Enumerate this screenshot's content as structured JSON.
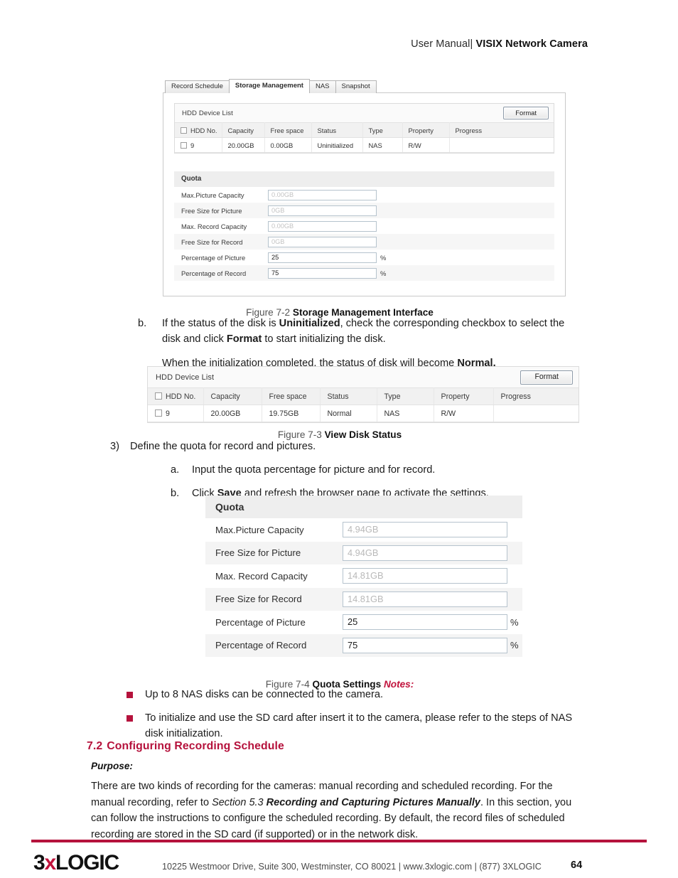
{
  "header": {
    "plain": "User Manual|",
    "bold": "VISIX Network Camera"
  },
  "figure_7_2": {
    "tabs": [
      {
        "label": "Record Schedule",
        "active": false
      },
      {
        "label": "Storage Management",
        "active": true
      },
      {
        "label": "NAS",
        "active": false
      },
      {
        "label": "Snapshot",
        "active": false
      }
    ],
    "hdd_list": {
      "title": "HDD Device List",
      "format_button": "Format",
      "columns": [
        "HDD No.",
        "Capacity",
        "Free space",
        "Status",
        "Type",
        "Property",
        "Progress"
      ],
      "rows": [
        {
          "no": "9",
          "capacity": "20.00GB",
          "free_space": "0.00GB",
          "status": "Uninitialized",
          "type": "NAS",
          "property": "R/W",
          "progress": ""
        }
      ]
    },
    "quota": {
      "title": "Quota",
      "fields": [
        {
          "label": "Max.Picture Capacity",
          "value": "0.00GB",
          "readonly": true,
          "suffix": ""
        },
        {
          "label": "Free Size for Picture",
          "value": "0GB",
          "readonly": true,
          "suffix": ""
        },
        {
          "label": "Max. Record Capacity",
          "value": "0.00GB",
          "readonly": true,
          "suffix": ""
        },
        {
          "label": "Free Size for Record",
          "value": "0GB",
          "readonly": true,
          "suffix": ""
        },
        {
          "label": "Percentage of Picture",
          "value": "25",
          "readonly": false,
          "suffix": "%"
        },
        {
          "label": "Percentage of Record",
          "value": "75",
          "readonly": false,
          "suffix": "%"
        }
      ]
    },
    "caption_num": "Figure 7-2",
    "caption_title": "Storage Management Interface"
  },
  "step_b": {
    "marker": "b.",
    "line1_pre": "If the status of the disk is ",
    "line1_bold1": "Uninitialized",
    "line1_mid": ", check the corresponding checkbox to select the disk and click ",
    "line1_bold2": "Format",
    "line1_post": " to start initializing the disk.",
    "line2_pre": "When the initialization completed, the status of disk will become ",
    "line2_bold": "Normal."
  },
  "figure_7_3": {
    "hdd_list": {
      "title": "HDD Device List",
      "format_button": "Format",
      "columns": [
        "HDD No.",
        "Capacity",
        "Free space",
        "Status",
        "Type",
        "Property",
        "Progress"
      ],
      "rows": [
        {
          "no": "9",
          "capacity": "20.00GB",
          "free_space": "19.75GB",
          "status": "Normal",
          "type": "NAS",
          "property": "R/W",
          "progress": ""
        }
      ]
    },
    "caption_num": "Figure 7-3",
    "caption_title": "View Disk Status"
  },
  "step_3": {
    "marker": "3)",
    "text": "Define the quota for record and pictures.",
    "sub_a_marker": "a.",
    "sub_a_text": "Input the quota percentage for picture and for record.",
    "sub_b_marker": "b.",
    "sub_b_pre": "Click ",
    "sub_b_bold": "Save",
    "sub_b_post": " and refresh the browser page to activate the settings."
  },
  "figure_7_4": {
    "quota": {
      "title": "Quota",
      "fields": [
        {
          "label": "Max.Picture Capacity",
          "value": "4.94GB",
          "readonly": true,
          "suffix": ""
        },
        {
          "label": "Free Size for Picture",
          "value": "4.94GB",
          "readonly": true,
          "suffix": ""
        },
        {
          "label": "Max. Record Capacity",
          "value": "14.81GB",
          "readonly": true,
          "suffix": ""
        },
        {
          "label": "Free Size for Record",
          "value": "14.81GB",
          "readonly": true,
          "suffix": ""
        },
        {
          "label": "Percentage of Picture",
          "value": "25",
          "readonly": false,
          "suffix": "%"
        },
        {
          "label": "Percentage of Record",
          "value": "75",
          "readonly": false,
          "suffix": "%"
        }
      ]
    },
    "caption_num": "Figure 7-4",
    "caption_title": "Quota Settings",
    "caption_notes": "Notes:"
  },
  "notes": [
    "Up to 8 NAS disks can be connected to the camera.",
    "To initialize and use the SD card after insert it to the camera, please refer to the steps of NAS disk initialization."
  ],
  "section": {
    "number": "7.2",
    "title": "Configuring Recording Schedule",
    "purpose_label": "Purpose:",
    "para_pre": "There are two kinds of recording for the cameras: manual recording and scheduled recording. For the manual recording, refer to ",
    "para_italic": "Section 5.3",
    "para_bold_italic": "Recording and Capturing Pictures Manually",
    "para_post": ". In this section, you can follow the instructions to configure the scheduled recording. By default, the record files of scheduled recording are stored in the SD card (if supported) or in the network disk."
  },
  "footer": {
    "logo_pre": "3",
    "logo_x": "x",
    "logo_post": "LOGIC",
    "address": "10225 Westmoor Drive, Suite 300, Westminster, CO 80021 | www.3xlogic.com | (877) 3XLOGIC",
    "page_number": "64"
  },
  "colors": {
    "brand_red": "#b5123c",
    "accent_red": "#c1123c",
    "panel_border": "#c9c9c9",
    "row_shade": "#f4f4f4"
  }
}
